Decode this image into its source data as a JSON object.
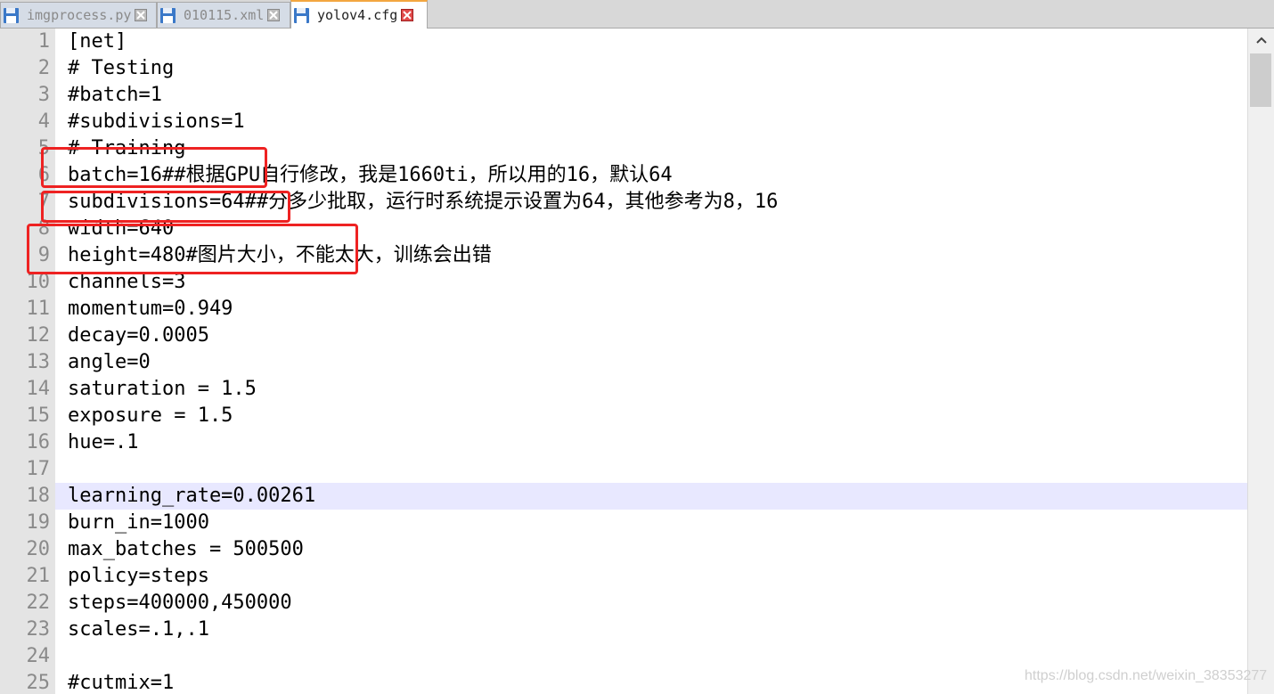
{
  "tabs": [
    {
      "label": "imgprocess.py",
      "active": false
    },
    {
      "label": "010115.xml",
      "active": false
    },
    {
      "label": "yolov4.cfg",
      "active": true
    }
  ],
  "icons": {
    "file": "floppy-disk-icon",
    "close": "close-icon",
    "scroll_up": "chevron-up-icon"
  },
  "colors": {
    "highlight_box": "#ee2222",
    "current_line": "#e8e8ff",
    "gutter": "#e4e4e4",
    "active_tab_accent": "#f3a640"
  },
  "current_line": 18,
  "editor_lines": [
    {
      "num": "1",
      "text": "[net]"
    },
    {
      "num": "2",
      "text": "# Testing"
    },
    {
      "num": "3",
      "text": "#batch=1"
    },
    {
      "num": "4",
      "text": "#subdivisions=1"
    },
    {
      "num": "5",
      "text": "# Training"
    },
    {
      "num": "6",
      "text": "batch=16##根据GPU自行修改，我是1660ti，所以用的16，默认64"
    },
    {
      "num": "7",
      "text": "subdivisions=64##分多少批取，运行时系统提示设置为64，其他参考为8，16"
    },
    {
      "num": "8",
      "text": "width=640"
    },
    {
      "num": "9",
      "text": "height=480#图片大小，不能太大，训练会出错"
    },
    {
      "num": "10",
      "text": "channels=3"
    },
    {
      "num": "11",
      "text": "momentum=0.949"
    },
    {
      "num": "12",
      "text": "decay=0.0005"
    },
    {
      "num": "13",
      "text": "angle=0"
    },
    {
      "num": "14",
      "text": "saturation = 1.5"
    },
    {
      "num": "15",
      "text": "exposure = 1.5"
    },
    {
      "num": "16",
      "text": "hue=.1"
    },
    {
      "num": "17",
      "text": ""
    },
    {
      "num": "18",
      "text": "learning_rate=0.00261"
    },
    {
      "num": "19",
      "text": "burn_in=1000"
    },
    {
      "num": "20",
      "text": "max_batches = 500500"
    },
    {
      "num": "21",
      "text": "policy=steps"
    },
    {
      "num": "22",
      "text": "steps=400000,450000"
    },
    {
      "num": "23",
      "text": "scales=.1,.1"
    },
    {
      "num": "24",
      "text": ""
    },
    {
      "num": "25",
      "text": "#cutmix=1"
    }
  ],
  "watermark": "https://blog.csdn.net/weixin_38353277"
}
